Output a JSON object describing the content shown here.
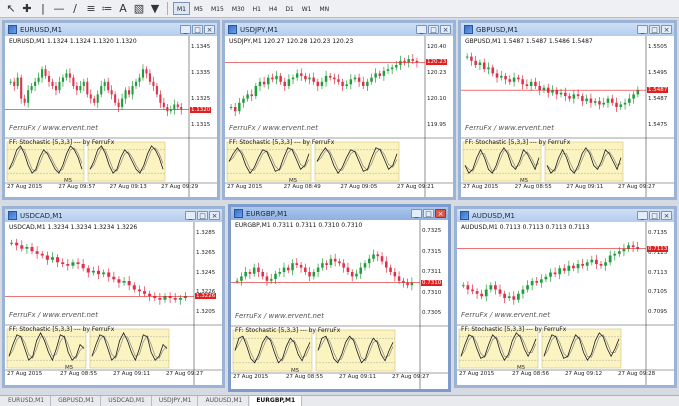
{
  "toolbar": {
    "timeframes": [
      "M1",
      "M5",
      "M15",
      "M30",
      "H1",
      "H4",
      "D1",
      "W1",
      "MN"
    ],
    "active_timeframe": "M1"
  },
  "windows": [
    {
      "title": "EURUSD,M1",
      "symbol_line": "EURUSD,M1  1.1324 1.1324 1.1320 1.1320",
      "prices": [
        "1.1345",
        "1.1335",
        "1.1325",
        "1.1315"
      ],
      "last_price": "1.1320",
      "watermark": "FerruFx / www.ervent.net",
      "indicator": "FF: Stochastic [5,3,3] --- by FerruFx",
      "time_labels": [
        "27 Aug 2015",
        "27 Aug 09:57",
        "27 Aug 09:13",
        "27 Aug 09:29"
      ],
      "ms_label": "M5",
      "candles": [
        0.55,
        0.5,
        0.6,
        0.35,
        0.3,
        0.45,
        0.5,
        0.55,
        0.6,
        0.7,
        0.62,
        0.55,
        0.5,
        0.45,
        0.55,
        0.6,
        0.65,
        0.6,
        0.5,
        0.45,
        0.5,
        0.55,
        0.4,
        0.35,
        0.3,
        0.4,
        0.5,
        0.55,
        0.45,
        0.4,
        0.3,
        0.25,
        0.35,
        0.45,
        0.4,
        0.5,
        0.55,
        0.6,
        0.7,
        0.65,
        0.55,
        0.5,
        0.4,
        0.3,
        0.25,
        0.2,
        0.22,
        0.28,
        0.25,
        0.22
      ],
      "stoch": [
        0.3,
        0.5,
        0.8,
        0.9,
        0.7,
        0.4,
        0.2,
        0.3,
        0.6,
        0.8,
        0.7,
        0.5,
        0.3,
        0.2,
        0.4,
        0.7,
        0.9,
        0.8,
        0.6,
        0.3
      ]
    },
    {
      "title": "USDJPY,M1",
      "symbol_line": "USDJPY,M1  120.27 120.28 120.23 120.23",
      "prices": [
        "120.40",
        "120.23",
        "120.10",
        "119.95"
      ],
      "last_price": "120.23",
      "watermark": "FerruFx / www.ervent.net",
      "indicator": "FF: Stochastic [5,3,3] --- by FerruFx",
      "time_labels": [
        "27 Aug 2015",
        "27 Aug 08:49",
        "27 Aug 09:05",
        "27 Aug 09:21"
      ],
      "ms_label": "M5",
      "candles": [
        0.25,
        0.2,
        0.3,
        0.35,
        0.4,
        0.38,
        0.5,
        0.55,
        0.52,
        0.6,
        0.58,
        0.62,
        0.55,
        0.5,
        0.58,
        0.6,
        0.65,
        0.62,
        0.58,
        0.6,
        0.55,
        0.5,
        0.55,
        0.62,
        0.6,
        0.58,
        0.55,
        0.5,
        0.52,
        0.58,
        0.6,
        0.55,
        0.5,
        0.55,
        0.6,
        0.65,
        0.62,
        0.68,
        0.7,
        0.72,
        0.75,
        0.8,
        0.78,
        0.82,
        0.8,
        0.78
      ],
      "stoch": [
        0.5,
        0.7,
        0.85,
        0.7,
        0.4,
        0.2,
        0.35,
        0.6,
        0.8,
        0.75,
        0.5,
        0.25,
        0.3,
        0.6,
        0.85,
        0.8,
        0.55,
        0.3,
        0.4,
        0.7
      ]
    },
    {
      "title": "GBPUSD,M1",
      "symbol_line": "GBPUSD,M1  1.5487 1.5487 1.5486 1.5487",
      "prices": [
        "1.5505",
        "1.5495",
        "1.5487",
        "1.5475"
      ],
      "last_price": "1.5487",
      "watermark": "FerruFx / www.ervent.net",
      "indicator": "FF: Stochastic [5,3,3] --- by FerruFx",
      "time_labels": [
        "27 Aug 2015",
        "27 Aug 08:55",
        "27 Aug 09:11",
        "27 Aug 09:27"
      ],
      "ms_label": "M5",
      "candles": [
        0.85,
        0.8,
        0.75,
        0.78,
        0.7,
        0.72,
        0.65,
        0.6,
        0.62,
        0.58,
        0.55,
        0.6,
        0.58,
        0.52,
        0.5,
        0.55,
        0.5,
        0.45,
        0.48,
        0.42,
        0.45,
        0.4,
        0.42,
        0.38,
        0.35,
        0.4,
        0.38,
        0.32,
        0.35,
        0.3,
        0.32,
        0.28,
        0.3,
        0.35,
        0.3,
        0.25,
        0.28,
        0.3,
        0.35,
        0.4,
        0.45
      ],
      "stoch": [
        0.4,
        0.2,
        0.3,
        0.6,
        0.8,
        0.6,
        0.3,
        0.2,
        0.4,
        0.7,
        0.85,
        0.7,
        0.4,
        0.3,
        0.5,
        0.8,
        0.7,
        0.5,
        0.3,
        0.6
      ]
    },
    {
      "title": "USDCAD,M1",
      "symbol_line": "USDCAD,M1  1.3234 1.3234 1.3234 1.3226",
      "prices": [
        "1.3285",
        "1.3265",
        "1.3245",
        "1.3226",
        "1.3205"
      ],
      "last_price": "1.3226",
      "watermark": "FerruFx / www.ervent.net",
      "indicator": "FF: Stochastic [5,3,3] --- by FerruFx",
      "time_labels": [
        "27 Aug 2015",
        "27 Aug 08:55",
        "27 Aug 09:11",
        "27 Aug 09:27"
      ],
      "ms_label": "M5",
      "candles": [
        0.85,
        0.82,
        0.78,
        0.8,
        0.75,
        0.72,
        0.7,
        0.65,
        0.68,
        0.62,
        0.6,
        0.58,
        0.62,
        0.6,
        0.55,
        0.5,
        0.52,
        0.48,
        0.5,
        0.45,
        0.42,
        0.38,
        0.4,
        0.35,
        0.3,
        0.28,
        0.25,
        0.22,
        0.2,
        0.18,
        0.22,
        0.2,
        0.18,
        0.2,
        0.22
      ],
      "stoch": [
        0.3,
        0.6,
        0.85,
        0.8,
        0.5,
        0.2,
        0.3,
        0.7,
        0.9,
        0.7,
        0.4,
        0.2,
        0.5,
        0.85,
        0.8,
        0.4,
        0.2,
        0.3,
        0.6,
        0.5
      ]
    },
    {
      "title": "EURGBP,M1",
      "symbol_line": "EURGBP,M1  0.7311 0.7311 0.7310 0.7310",
      "prices": [
        "0.7325",
        "0.7315",
        "0.7311",
        "0.7310",
        "0.7305"
      ],
      "last_price": "0.7310",
      "watermark": "FerruFx / www.ervent.net",
      "indicator": "FF: Stochastic [5,3,3] --- by FerruFx",
      "time_labels": [
        "27 Aug 2015",
        "27 Aug 08:55",
        "27 Aug 09:11",
        "27 Aug 09:27"
      ],
      "ms_label": "M5",
      "candles": [
        0.4,
        0.45,
        0.5,
        0.48,
        0.55,
        0.5,
        0.45,
        0.4,
        0.42,
        0.48,
        0.5,
        0.55,
        0.52,
        0.6,
        0.58,
        0.55,
        0.5,
        0.45,
        0.5,
        0.55,
        0.6,
        0.58,
        0.65,
        0.62,
        0.6,
        0.55,
        0.5,
        0.45,
        0.48,
        0.55,
        0.6,
        0.65,
        0.7,
        0.68,
        0.62,
        0.55,
        0.5,
        0.45,
        0.4,
        0.38,
        0.35,
        0.38
      ],
      "stoch": [
        0.5,
        0.8,
        0.85,
        0.6,
        0.3,
        0.2,
        0.4,
        0.7,
        0.85,
        0.75,
        0.45,
        0.2,
        0.3,
        0.6,
        0.8,
        0.7,
        0.4,
        0.25,
        0.5,
        0.7
      ]
    },
    {
      "title": "AUDUSD,M1",
      "symbol_line": "AUDUSD,M1  0.7113 0.7113 0.7113 0.7113",
      "prices": [
        "0.7135",
        "0.7125",
        "0.7113",
        "0.7105",
        "0.7095"
      ],
      "last_price": "0.7113",
      "watermark": "FerruFx / www.ervent.net",
      "indicator": "FF: Stochastic [5,3,3] --- by FerruFx",
      "time_labels": [
        "27 Aug 2015",
        "27 Aug 08:56",
        "27 Aug 09:12",
        "27 Aug 09:28"
      ],
      "ms_label": "M5",
      "candles": [
        0.35,
        0.3,
        0.28,
        0.25,
        0.22,
        0.3,
        0.35,
        0.3,
        0.25,
        0.2,
        0.22,
        0.18,
        0.25,
        0.3,
        0.35,
        0.4,
        0.38,
        0.42,
        0.45,
        0.5,
        0.48,
        0.55,
        0.52,
        0.58,
        0.55,
        0.6,
        0.58,
        0.62,
        0.65,
        0.6,
        0.58,
        0.62,
        0.7,
        0.72,
        0.75,
        0.78,
        0.82,
        0.8,
        0.78
      ],
      "stoch": [
        0.3,
        0.6,
        0.85,
        0.8,
        0.5,
        0.25,
        0.3,
        0.6,
        0.85,
        0.75,
        0.4,
        0.2,
        0.35,
        0.7,
        0.9,
        0.8,
        0.5,
        0.3,
        0.5,
        0.75
      ]
    }
  ],
  "tabs": [
    "EURUSD,M1",
    "GBPUSD,M1",
    "USDCAD,M1",
    "USDJPY,M1",
    "AUDUSD,M1",
    "EURGBP,M1"
  ],
  "active_tab": "EURGBP,M1",
  "colors": {
    "bull": "#1f9e3a",
    "bear": "#e0304a",
    "stoch_main": "#1a1a1a",
    "stoch_signal": "#888888",
    "indicator_bg": "#fbf3c0",
    "price_line": "#e02020"
  }
}
